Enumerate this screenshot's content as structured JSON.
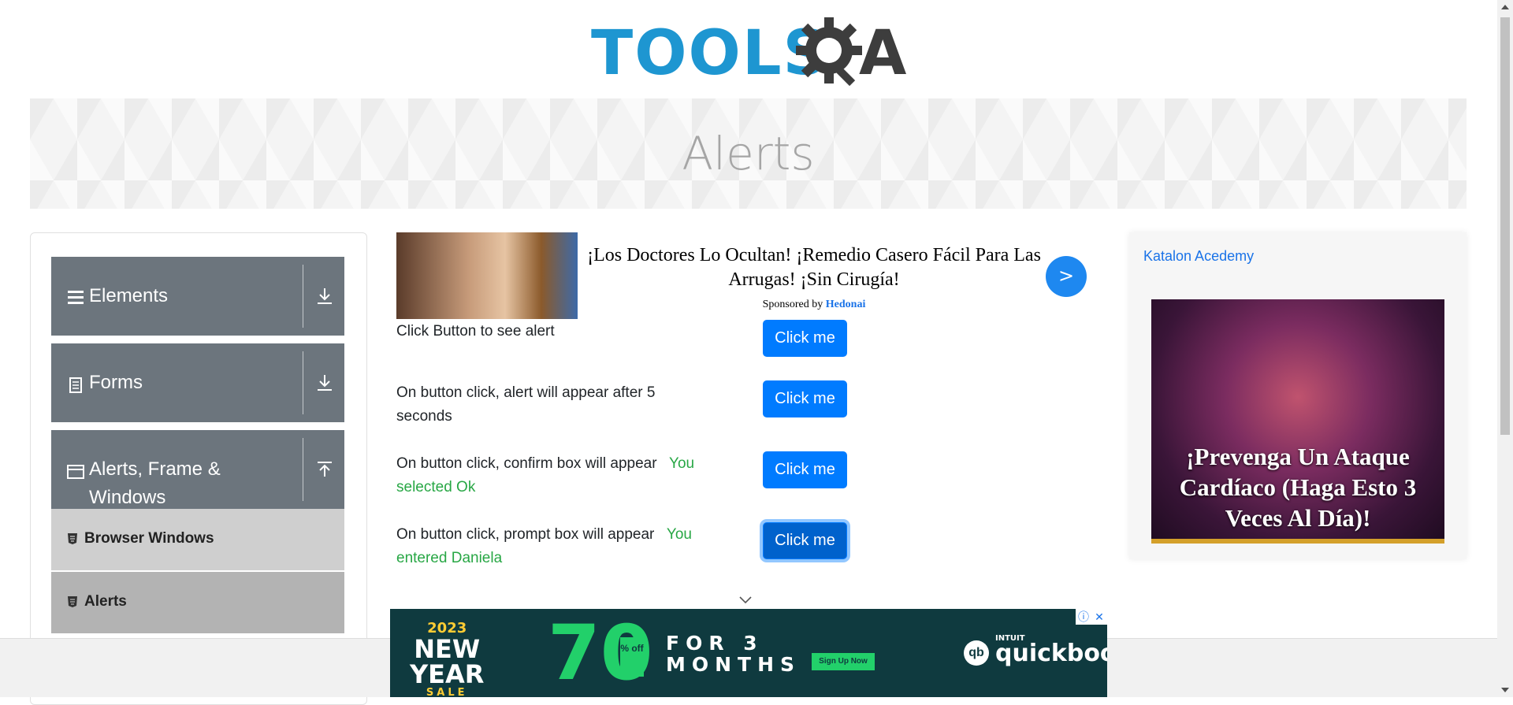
{
  "logo": {
    "left": "TOOLS",
    "right": "A"
  },
  "banner": {
    "title": "Alerts"
  },
  "sidebar": {
    "groups": [
      {
        "label": "Elements"
      },
      {
        "label": "Forms"
      },
      {
        "label_line1": "Alerts, Frame &",
        "label_line2": "Windows"
      }
    ],
    "items": [
      {
        "label": "Browser Windows"
      },
      {
        "label": "Alerts"
      }
    ]
  },
  "ad_top": {
    "headline": "¡Los Doctores Lo Ocultan! ¡Remedio Casero Fácil Para Las Arrugas! ¡Sin Cirugía!",
    "sponsored_prefix": "Sponsored by",
    "sponsor": "Hedonai",
    "arrow": ">"
  },
  "alerts": [
    {
      "label": "Click Button to see alert",
      "result": "",
      "button": "Click me"
    },
    {
      "label": "On button click, alert will appear after 5 seconds",
      "result": "",
      "button": "Click me"
    },
    {
      "label": "On button click, confirm box will appear",
      "result": "You selected Ok",
      "button": "Click me"
    },
    {
      "label": "On button click, prompt box will appear",
      "result": "You entered Daniela",
      "button": "Click me"
    }
  ],
  "ad_right": {
    "alt_link": "Katalon Acedemy",
    "headline": "¡Prevenga Un Ataque Cardíaco (Haga Esto 3 Veces Al Día)!"
  },
  "ad_bottom": {
    "year": "2023",
    "new": "NEW",
    "year_word": "YEAR",
    "sale": "SALE",
    "percent": "70",
    "off": "% off",
    "for": "FOR 3",
    "months": "MONTHS",
    "signup": "Sign Up Now",
    "brand_small": "INTUIT",
    "brand": "quickbooks"
  },
  "colors": {
    "primary": "#007bff",
    "sidebar_group": "#6c757d",
    "success": "#28a745",
    "logo_blue": "#1e96d1"
  }
}
